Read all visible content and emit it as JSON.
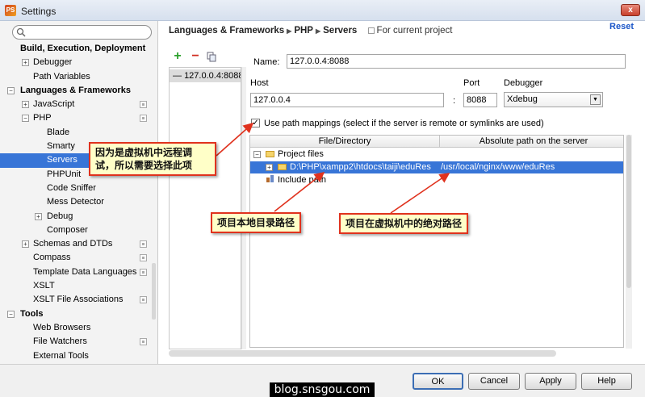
{
  "window": {
    "title": "Settings",
    "app_icon": "php-storm-icon",
    "close_glyph": "x"
  },
  "search": {
    "placeholder": ""
  },
  "tree": [
    {
      "label": "Build, Execution, Deployment",
      "indent": 0,
      "bold": true,
      "expander": "",
      "project": false,
      "selected": false
    },
    {
      "label": "Debugger",
      "indent": 1,
      "bold": false,
      "expander": "+",
      "project": false,
      "selected": false
    },
    {
      "label": "Path Variables",
      "indent": 1,
      "bold": false,
      "expander": "",
      "project": false,
      "selected": false
    },
    {
      "label": "Languages & Frameworks",
      "indent": 0,
      "bold": true,
      "expander": "−",
      "project": false,
      "selected": false
    },
    {
      "label": "JavaScript",
      "indent": 1,
      "bold": false,
      "expander": "+",
      "project": true,
      "selected": false
    },
    {
      "label": "PHP",
      "indent": 1,
      "bold": false,
      "expander": "−",
      "project": true,
      "selected": false
    },
    {
      "label": "Blade",
      "indent": 2,
      "bold": false,
      "expander": "",
      "project": false,
      "selected": false
    },
    {
      "label": "Smarty",
      "indent": 2,
      "bold": false,
      "expander": "",
      "project": false,
      "selected": false
    },
    {
      "label": "Servers",
      "indent": 2,
      "bold": false,
      "expander": "",
      "project": true,
      "selected": true
    },
    {
      "label": "PHPUnit",
      "indent": 2,
      "bold": false,
      "expander": "",
      "project": false,
      "selected": false
    },
    {
      "label": "Code Sniffer",
      "indent": 2,
      "bold": false,
      "expander": "",
      "project": false,
      "selected": false
    },
    {
      "label": "Mess Detector",
      "indent": 2,
      "bold": false,
      "expander": "",
      "project": false,
      "selected": false
    },
    {
      "label": "Debug",
      "indent": 2,
      "bold": false,
      "expander": "+",
      "project": false,
      "selected": false
    },
    {
      "label": "Composer",
      "indent": 2,
      "bold": false,
      "expander": "",
      "project": false,
      "selected": false
    },
    {
      "label": "Schemas and DTDs",
      "indent": 1,
      "bold": false,
      "expander": "+",
      "project": true,
      "selected": false
    },
    {
      "label": "Compass",
      "indent": 1,
      "bold": false,
      "expander": "",
      "project": true,
      "selected": false
    },
    {
      "label": "Template Data Languages",
      "indent": 1,
      "bold": false,
      "expander": "",
      "project": true,
      "selected": false
    },
    {
      "label": "XSLT",
      "indent": 1,
      "bold": false,
      "expander": "",
      "project": false,
      "selected": false
    },
    {
      "label": "XSLT File Associations",
      "indent": 1,
      "bold": false,
      "expander": "",
      "project": true,
      "selected": false
    },
    {
      "label": "Tools",
      "indent": 0,
      "bold": true,
      "expander": "−",
      "project": false,
      "selected": false
    },
    {
      "label": "Web Browsers",
      "indent": 1,
      "bold": false,
      "expander": "",
      "project": false,
      "selected": false
    },
    {
      "label": "File Watchers",
      "indent": 1,
      "bold": false,
      "expander": "",
      "project": true,
      "selected": false
    },
    {
      "label": "External Tools",
      "indent": 1,
      "bold": false,
      "expander": "",
      "project": false,
      "selected": false
    }
  ],
  "breadcrumb": {
    "part1": "Languages & Frameworks",
    "part2": "PHP",
    "part3": "Servers",
    "project_note": "For current project"
  },
  "reset_label": "Reset",
  "toolbar": {
    "add": "+",
    "remove": "−",
    "copy": ""
  },
  "server_list": [
    "127.0.0.4:8088"
  ],
  "form": {
    "name_label": "Name:",
    "name_value": "127.0.0.4:8088",
    "host_label": "Host",
    "host_value": "127.0.0.4",
    "colon": ":",
    "port_label": "Port",
    "port_value": "8088",
    "debugger_label": "Debugger",
    "debugger_value": "Xdebug"
  },
  "mappings": {
    "checkbox_checked": true,
    "checkbox_label": "Use path mappings (select if the server is remote or symlinks are used)",
    "col_file": "File/Directory",
    "col_abs": "Absolute path on the server",
    "project_files": "Project files",
    "local_path": "D:\\PHP\\xampp2\\htdocs\\taiji\\eduRes",
    "remote_path": "/usr/local/nginx/www/eduRes",
    "include_path": "Include path"
  },
  "annotations": {
    "remote_note_line1": "因为是虚拟机中远程调",
    "remote_note_line2": "试，所以需要选择此项",
    "local_note": "项目本地目录路径",
    "abs_note": "项目在虚拟机中的绝对路径",
    "border_color": "#e0321e"
  },
  "buttons": {
    "ok": "OK",
    "cancel": "Cancel",
    "apply": "Apply",
    "help": "Help"
  },
  "watermark": "blog.snsgou.com",
  "colors": {
    "selection": "#3875d7",
    "link": "#1a55c8"
  }
}
